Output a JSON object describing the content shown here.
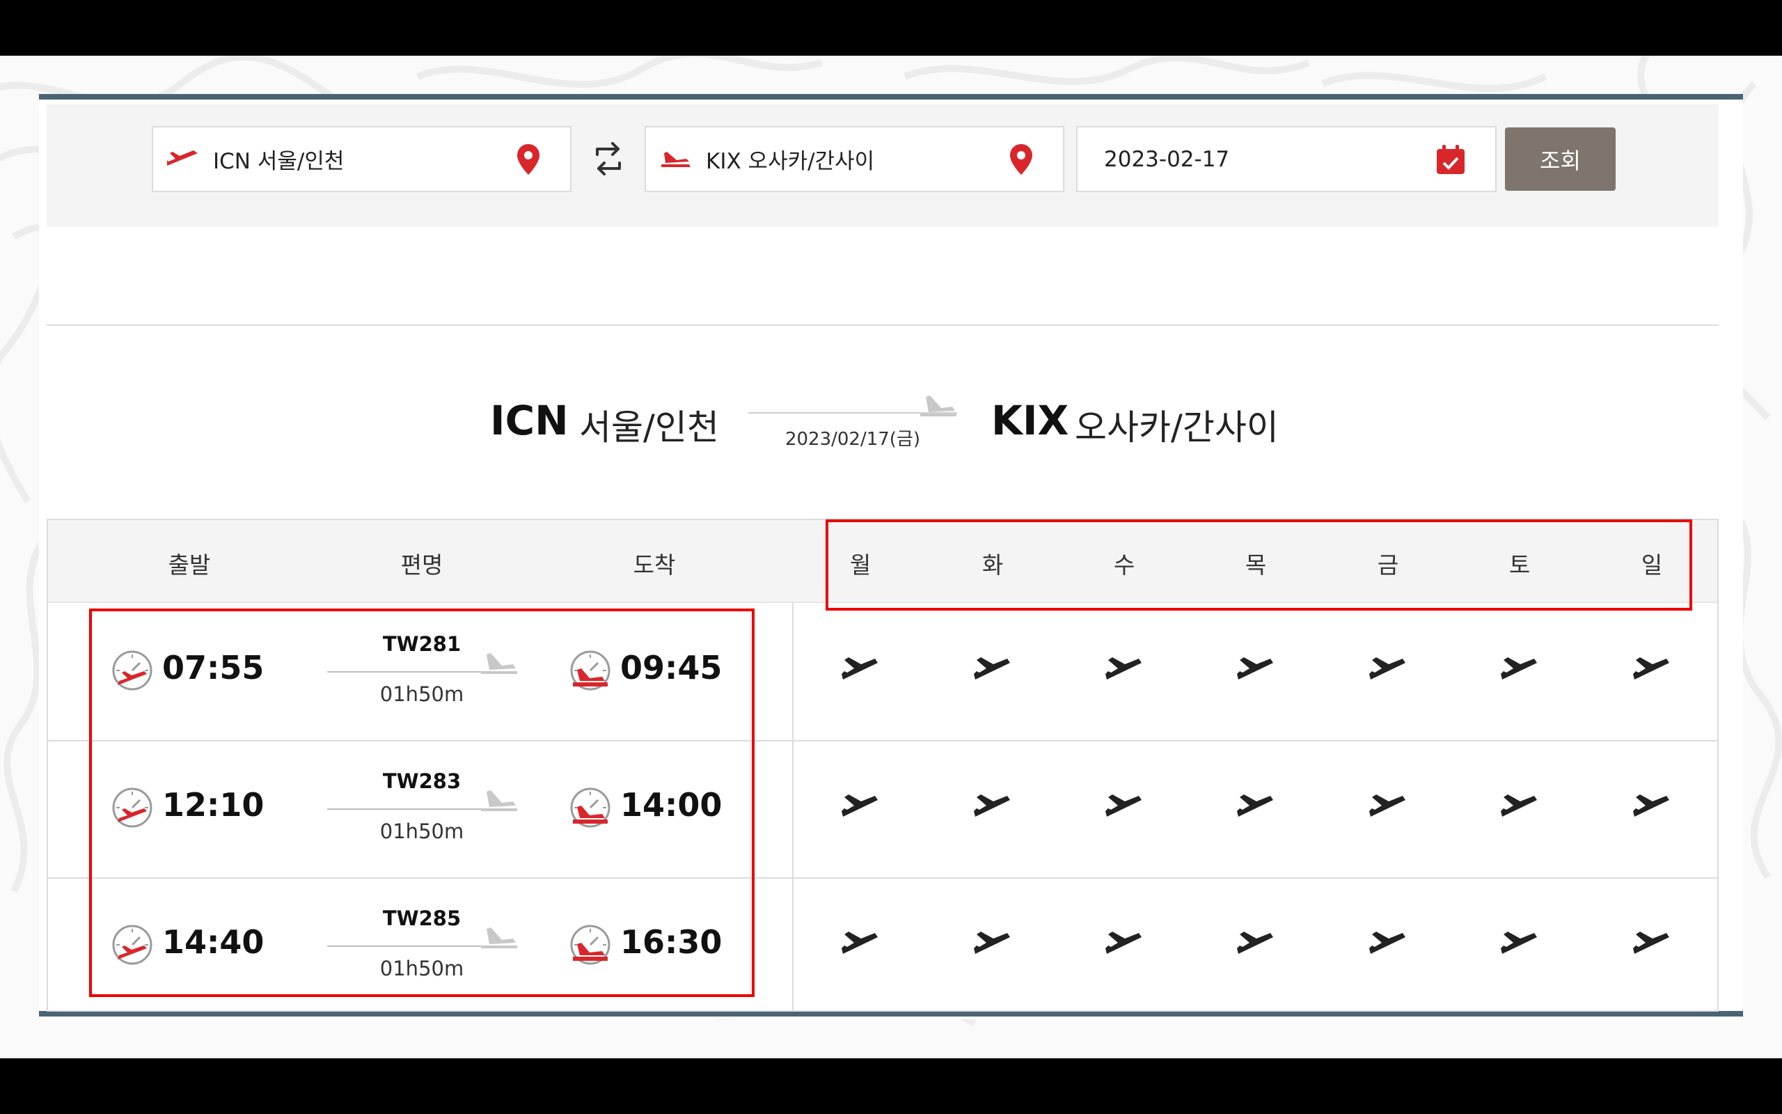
{
  "search": {
    "origin": "ICN 서울/인천",
    "destination": "KIX 오사카/간사이",
    "date": "2023-02-17",
    "button": "조회"
  },
  "route": {
    "origin_code": "ICN",
    "origin_city": "서울/인천",
    "destination_code": "KIX",
    "destination_city": "오사카/간사이",
    "date": "2023/02/17(금)"
  },
  "table": {
    "headers": {
      "departure": "출발",
      "flight_no": "편명",
      "arrival": "도착"
    },
    "days": [
      "월",
      "화",
      "수",
      "목",
      "금",
      "토",
      "일"
    ],
    "rows": [
      {
        "dep": "07:55",
        "flight": "TW281",
        "duration": "01h50m",
        "arr": "09:45"
      },
      {
        "dep": "12:10",
        "flight": "TW283",
        "duration": "01h50m",
        "arr": "14:00"
      },
      {
        "dep": "14:40",
        "flight": "TW285",
        "duration": "01h50m",
        "arr": "16:30"
      }
    ]
  },
  "colors": {
    "accent": "#d9262b",
    "button": "#7e756e",
    "rule": "#4a6473",
    "highlight": "#ee0000"
  },
  "icons": {
    "departure_plane": "plane-takeoff-icon",
    "arrival_plane": "plane-landing-icon",
    "location": "map-pin-icon",
    "swap": "swap-arrows-icon",
    "calendar": "calendar-check-icon",
    "clock": "clock-plane-icon",
    "day_operates": "plane-icon"
  }
}
